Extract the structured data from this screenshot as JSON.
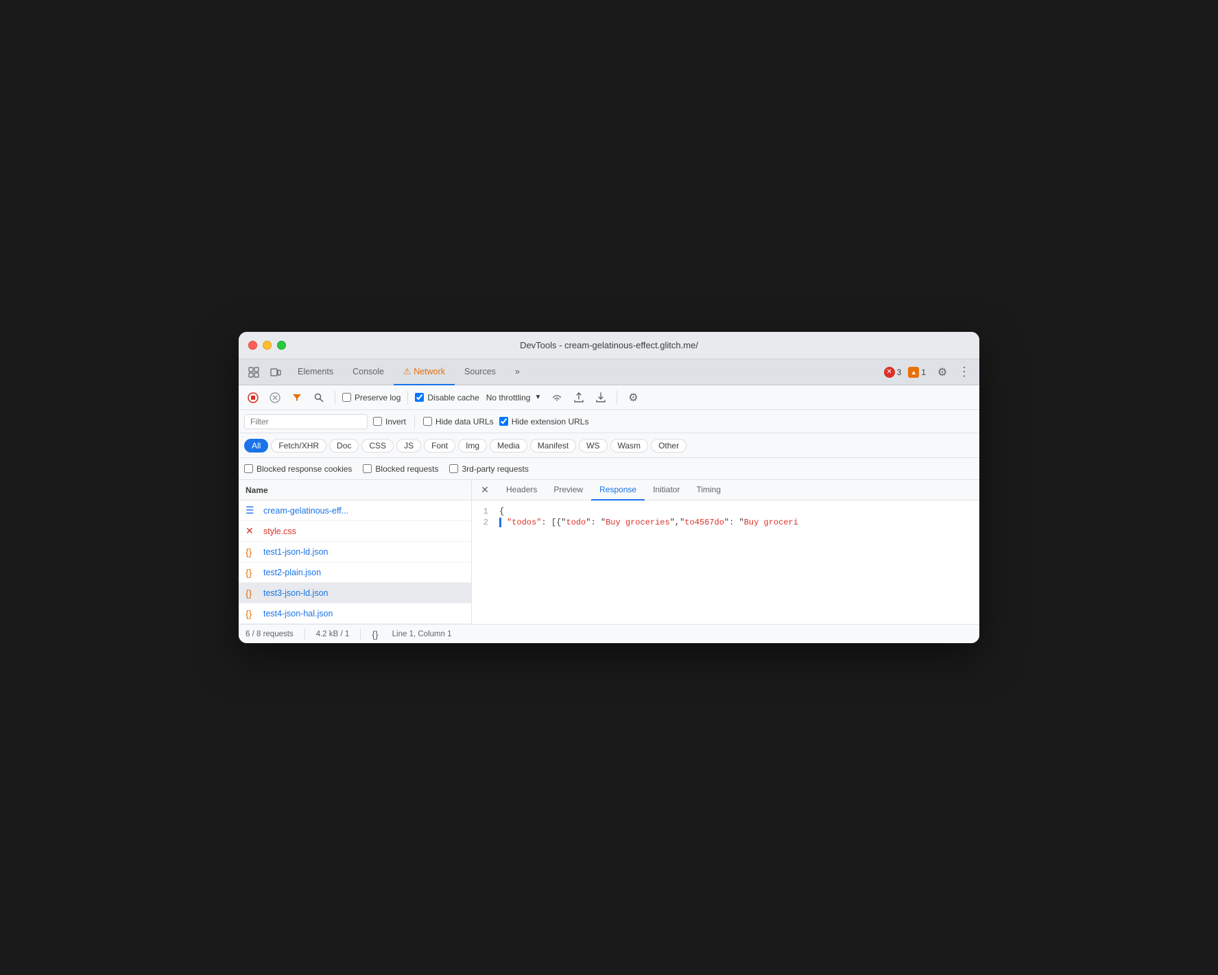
{
  "window": {
    "title": "DevTools - cream-gelatinous-effect.glitch.me/"
  },
  "tabs": {
    "items": [
      {
        "id": "elements",
        "label": "Elements",
        "active": false
      },
      {
        "id": "console",
        "label": "Console",
        "active": false
      },
      {
        "id": "network",
        "label": "Network",
        "active": true,
        "warning": true
      },
      {
        "id": "sources",
        "label": "Sources",
        "active": false
      }
    ],
    "more_label": "»"
  },
  "toolbar": {
    "error_count": "3",
    "warning_count": "1",
    "throttle_label": "No throttling",
    "preserve_log_label": "Preserve log",
    "disable_cache_label": "Disable cache"
  },
  "filter": {
    "placeholder": "Filter",
    "invert_label": "Invert",
    "hide_data_urls_label": "Hide data URLs",
    "hide_extension_urls_label": "Hide extension URLs"
  },
  "filter_types": [
    {
      "id": "all",
      "label": "All",
      "active": true
    },
    {
      "id": "fetch-xhr",
      "label": "Fetch/XHR",
      "active": false
    },
    {
      "id": "doc",
      "label": "Doc",
      "active": false
    },
    {
      "id": "css",
      "label": "CSS",
      "active": false
    },
    {
      "id": "js",
      "label": "JS",
      "active": false
    },
    {
      "id": "font",
      "label": "Font",
      "active": false
    },
    {
      "id": "img",
      "label": "Img",
      "active": false
    },
    {
      "id": "media",
      "label": "Media",
      "active": false
    },
    {
      "id": "manifest",
      "label": "Manifest",
      "active": false
    },
    {
      "id": "ws",
      "label": "WS",
      "active": false
    },
    {
      "id": "wasm",
      "label": "Wasm",
      "active": false
    },
    {
      "id": "other",
      "label": "Other",
      "active": false
    }
  ],
  "checkbox_row": {
    "blocked_cookies_label": "Blocked response cookies",
    "blocked_requests_label": "Blocked requests",
    "third_party_label": "3rd-party requests"
  },
  "file_list": {
    "header": "Name",
    "items": [
      {
        "id": "cream",
        "name": "cream-gelatinous-eff...",
        "icon_type": "doc",
        "selected": false
      },
      {
        "id": "style-css",
        "name": "style.css",
        "icon_type": "err",
        "selected": false
      },
      {
        "id": "test1",
        "name": "test1-json-ld.json",
        "icon_type": "json",
        "selected": false
      },
      {
        "id": "test2",
        "name": "test2-plain.json",
        "icon_type": "json",
        "selected": false
      },
      {
        "id": "test3",
        "name": "test3-json-ld.json",
        "icon_type": "json",
        "selected": true
      },
      {
        "id": "test4",
        "name": "test4-json-hal.json",
        "icon_type": "json",
        "selected": false
      }
    ]
  },
  "response_panel": {
    "tabs": [
      {
        "id": "headers",
        "label": "Headers",
        "active": false
      },
      {
        "id": "preview",
        "label": "Preview",
        "active": false
      },
      {
        "id": "response",
        "label": "Response",
        "active": true
      },
      {
        "id": "initiator",
        "label": "Initiator",
        "active": false
      },
      {
        "id": "timing",
        "label": "Timing",
        "active": false
      }
    ],
    "code_lines": [
      {
        "num": "1",
        "content": "{",
        "type": "plain"
      },
      {
        "num": "2",
        "content": "  \"todos\": [{\"todo\": \"Buy groceries\",\"to4567do\": \"Buy groceri",
        "type": "json"
      }
    ]
  },
  "status_bar": {
    "requests": "6 / 8 requests",
    "size": "4.2 kB / 1",
    "position": "Line 1, Column 1"
  }
}
